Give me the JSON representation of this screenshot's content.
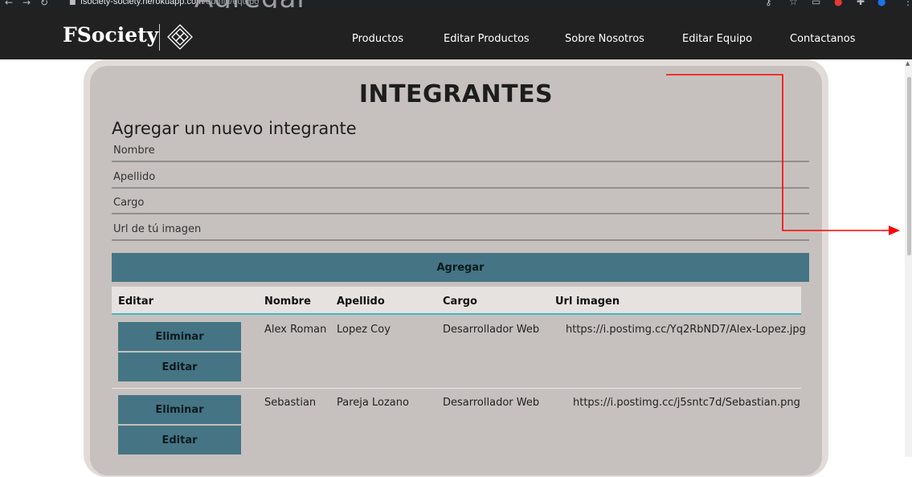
{
  "browser": {
    "url_host": "fsociety-society.herokuapp.com",
    "url_path": "/admin/equipo",
    "background_heading": "Agregar"
  },
  "nav": {
    "brand": "FSociety",
    "items": [
      "Productos",
      "Editar Productos",
      "Sobre Nosotros",
      "Editar Equipo",
      "Contactanos"
    ]
  },
  "page": {
    "title": "INTEGRANTES",
    "subtitle": "Agregar un nuevo integrante"
  },
  "form": {
    "fields": [
      {
        "placeholder": "Nombre"
      },
      {
        "placeholder": "Apellido"
      },
      {
        "placeholder": "Cargo"
      },
      {
        "placeholder": "Url de tú imagen"
      }
    ],
    "submit_label": "Agregar"
  },
  "table": {
    "headers": [
      "Editar",
      "Nombre",
      "Apellido",
      "Cargo",
      "Url imagen"
    ],
    "delete_label": "Eliminar",
    "edit_label": "Editar",
    "rows": [
      {
        "nombre": "Alex Roman",
        "apellido": "Lopez Coy",
        "cargo": "Desarrollador Web",
        "url": "https://i.postimg.cc/Yq2RbND7/Alex-Lopez.jpg"
      },
      {
        "nombre": "Sebastian",
        "apellido": "Pareja Lozano",
        "cargo": "Desarrollador Web",
        "url": "https://i.postimg.cc/j5sntc7d/Sebastian.png"
      }
    ]
  },
  "colors": {
    "navbar": "#212121",
    "card_outer": "#e1dcd9",
    "card_inner": "#c6c1be",
    "button": "#457584",
    "header_underline": "#49b7c4",
    "annotation_arrow": "#ff0000"
  },
  "icons": [
    "back-arrow-icon",
    "forward-arrow-icon",
    "reload-icon",
    "lock-icon",
    "key-icon",
    "star-icon",
    "extensions-icon",
    "profile-avatar-icon",
    "menu-dots-icon",
    "diamond-logo-icon"
  ]
}
